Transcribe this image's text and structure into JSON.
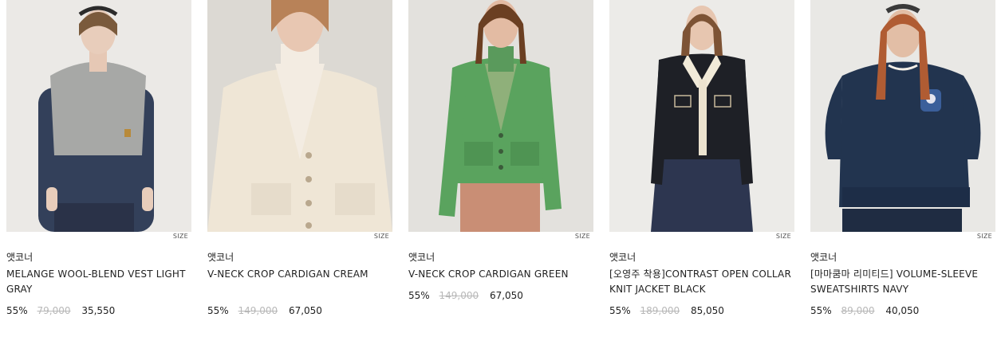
{
  "products": [
    {
      "brand": "앳코너",
      "name": "MELANGE WOOL-BLEND VEST LIGHT GRAY",
      "size_label": "SIZE",
      "discount": "55%",
      "original_price": "79,000",
      "sale_price": "35,550",
      "image_desc": "model in light gray hooded knit vest over navy shirt",
      "colors": {
        "bg": "#ebe9e6",
        "main": "#a7a8a6",
        "under": "#33405a"
      }
    },
    {
      "brand": "앳코너",
      "name": "V-NECK CROP CARDIGAN CREAM",
      "size_label": "SIZE",
      "discount": "55%",
      "original_price": "149,000",
      "sale_price": "67,050",
      "image_desc": "model in cream v-neck cardigan over turtleneck",
      "colors": {
        "bg": "#dcd9d3",
        "main": "#efe6d6",
        "under": "#f3ece2"
      }
    },
    {
      "brand": "앳코너",
      "name": "V-NECK CROP CARDIGAN GREEN",
      "size_label": "SIZE",
      "discount": "55%",
      "original_price": "149,000",
      "sale_price": "67,050",
      "image_desc": "model in green v-neck cardigan with brown corduroy pants",
      "colors": {
        "bg": "#e3e1dd",
        "main": "#5aa35e",
        "under": "#c98e75"
      }
    },
    {
      "brand": "앳코너",
      "name": "[오영주 착용]CONTRAST OPEN COLLAR KNIT JACKET BLACK",
      "size_label": "SIZE",
      "discount": "55%",
      "original_price": "189,000",
      "sale_price": "85,050",
      "image_desc": "model in black knit jacket with cream collar and navy skirt",
      "colors": {
        "bg": "#ecebe8",
        "main": "#1e2026",
        "under": "#2d3650"
      }
    },
    {
      "brand": "앳코너",
      "name": "[마마쿰마 리미티드] VOLUME-SLEEVE SWEATSHIRTS NAVY",
      "size_label": "SIZE",
      "discount": "55%",
      "original_price": "89,000",
      "sale_price": "40,050",
      "image_desc": "model in navy volume-sleeve sweatshirt",
      "colors": {
        "bg": "#e9e8e5",
        "main": "#22344f",
        "under": "#1f2c42"
      }
    }
  ]
}
